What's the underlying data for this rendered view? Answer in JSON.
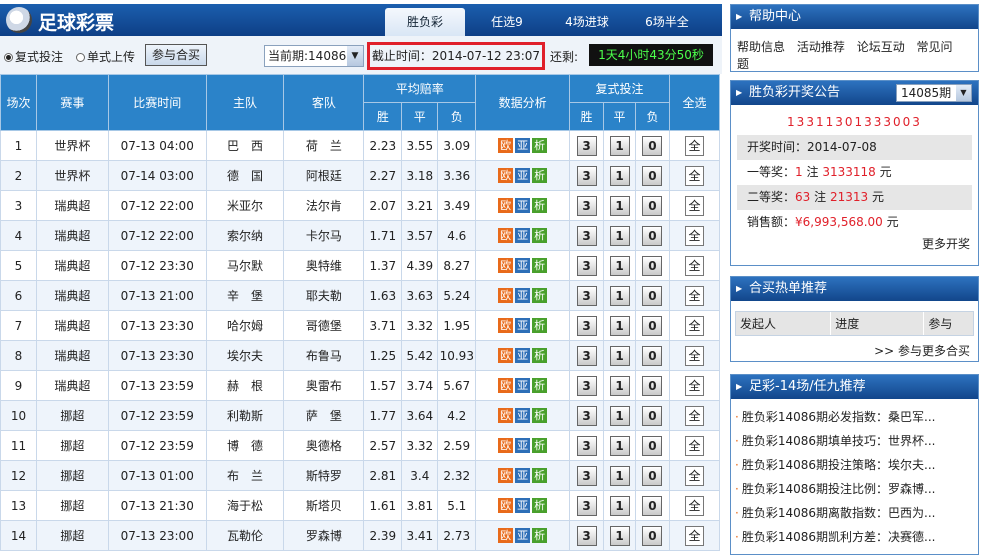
{
  "header": {
    "logo_text": "足球彩票",
    "tabs": [
      "胜负彩",
      "任选9",
      "4场进球",
      "6场半全"
    ],
    "active_tab": "胜负彩"
  },
  "toolbar": {
    "bet_mode_compound": "复式投注",
    "bet_mode_single": "单式上传",
    "group_buy_button": "参与合买",
    "period_select": "当前期:14086",
    "deadline": "截止时间：2014-07-12 23:07",
    "countdown_label": "还剩:",
    "countdown": "1天4小时43分50秒"
  },
  "table": {
    "headers": {
      "no": "场次",
      "event": "赛事",
      "time": "比赛时间",
      "home": "主队",
      "away": "客队",
      "odds": "平均赔率",
      "win": "胜",
      "draw": "平",
      "lose": "负",
      "analysis": "数据分析",
      "compound": "复式投注",
      "select_all": "全选"
    },
    "analysis_labels": [
      "欧",
      "亚",
      "析"
    ],
    "pick_labels": [
      "3",
      "1",
      "0"
    ],
    "all_label": "全",
    "rows": [
      {
        "no": "1",
        "event": "世界杯",
        "time": "07-13 04:00",
        "home": "巴　西",
        "away": "荷　兰",
        "w": "2.23",
        "d": "3.55",
        "l": "3.09"
      },
      {
        "no": "2",
        "event": "世界杯",
        "time": "07-14 03:00",
        "home": "德　国",
        "away": "阿根廷",
        "w": "2.27",
        "d": "3.18",
        "l": "3.36"
      },
      {
        "no": "3",
        "event": "瑞典超",
        "time": "07-12 22:00",
        "home": "米亚尔",
        "away": "法尔肯",
        "w": "2.07",
        "d": "3.21",
        "l": "3.49"
      },
      {
        "no": "4",
        "event": "瑞典超",
        "time": "07-12 22:00",
        "home": "索尔纳",
        "away": "卡尔马",
        "w": "1.71",
        "d": "3.57",
        "l": "4.6"
      },
      {
        "no": "5",
        "event": "瑞典超",
        "time": "07-12 23:30",
        "home": "马尔默",
        "away": "奥特维",
        "w": "1.37",
        "d": "4.39",
        "l": "8.27"
      },
      {
        "no": "6",
        "event": "瑞典超",
        "time": "07-13 21:00",
        "home": "辛　堡",
        "away": "耶夫勒",
        "w": "1.63",
        "d": "3.63",
        "l": "5.24"
      },
      {
        "no": "7",
        "event": "瑞典超",
        "time": "07-13 23:30",
        "home": "哈尔姆",
        "away": "哥德堡",
        "w": "3.71",
        "d": "3.32",
        "l": "1.95"
      },
      {
        "no": "8",
        "event": "瑞典超",
        "time": "07-13 23:30",
        "home": "埃尔夫",
        "away": "布鲁马",
        "w": "1.25",
        "d": "5.42",
        "l": "10.93"
      },
      {
        "no": "9",
        "event": "瑞典超",
        "time": "07-13 23:59",
        "home": "赫　根",
        "away": "奥雷布",
        "w": "1.57",
        "d": "3.74",
        "l": "5.67"
      },
      {
        "no": "10",
        "event": "挪超",
        "time": "07-12 23:59",
        "home": "利勒斯",
        "away": "萨　堡",
        "w": "1.77",
        "d": "3.64",
        "l": "4.2"
      },
      {
        "no": "11",
        "event": "挪超",
        "time": "07-12 23:59",
        "home": "博　德",
        "away": "奥德格",
        "w": "2.57",
        "d": "3.32",
        "l": "2.59"
      },
      {
        "no": "12",
        "event": "挪超",
        "time": "07-13 01:00",
        "home": "布　兰",
        "away": "斯特罗",
        "w": "2.81",
        "d": "3.4",
        "l": "2.32"
      },
      {
        "no": "13",
        "event": "挪超",
        "time": "07-13 21:30",
        "home": "海于松",
        "away": "斯塔贝",
        "w": "1.61",
        "d": "3.81",
        "l": "5.1"
      },
      {
        "no": "14",
        "event": "挪超",
        "time": "07-13 23:00",
        "home": "瓦勒伦",
        "away": "罗森博",
        "w": "2.39",
        "d": "3.41",
        "l": "2.73"
      }
    ]
  },
  "sidebar": {
    "help": {
      "title": "帮助中心",
      "links": [
        "帮助信息",
        "活动推荐",
        "论坛互动",
        "常见问题"
      ]
    },
    "draw": {
      "title": "胜负彩开奖公告",
      "period": "14085期",
      "numbers": "13311301333003",
      "date_label": "开奖时间：",
      "date": "2014-07-08",
      "first_label": "一等奖：",
      "first_count": "1",
      "first_unit": "注",
      "first_amount": "3133118",
      "first_currency": "元",
      "second_label": "二等奖：",
      "second_count": "63",
      "second_unit": "注",
      "second_amount": "21313",
      "second_currency": "元",
      "sales_label": "销售额：",
      "sales": "¥6,993,568.00",
      "sales_currency": "元",
      "more": "更多开奖"
    },
    "hot": {
      "title": "合买热单推荐",
      "cols": [
        "发起人",
        "进度",
        "参与"
      ],
      "more": ">> 参与更多合买"
    },
    "news": {
      "title": "足彩-14场/任九推荐",
      "items": [
        "胜负彩14086期必发指数：桑巴军...",
        "胜负彩14086期填单技巧：世界杯...",
        "胜负彩14086期投注策略：埃尔夫...",
        "胜负彩14086期投注比例：罗森博...",
        "胜负彩14086期离散指数：巴西为...",
        "胜负彩14086期凯利方差：决赛德..."
      ]
    }
  }
}
